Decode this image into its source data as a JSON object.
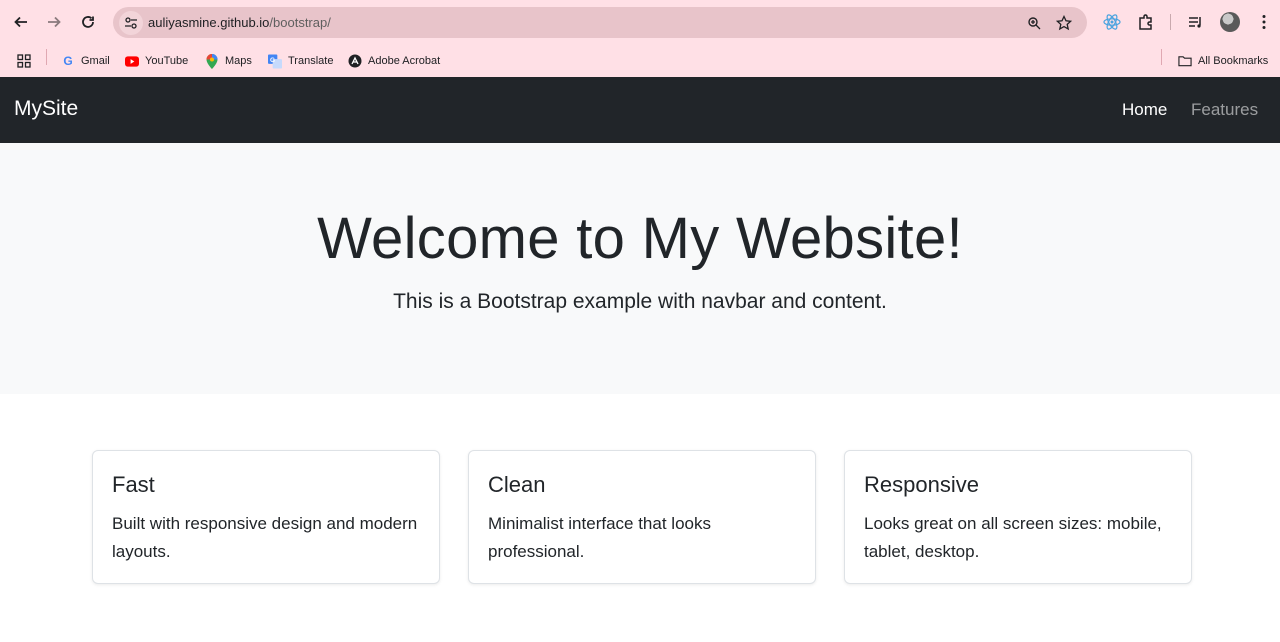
{
  "browser": {
    "url_host": "auliyasmine.github.io",
    "url_path": "/bootstrap/",
    "bookmarks": [
      {
        "label": "Gmail",
        "icon": "gmail-icon"
      },
      {
        "label": "YouTube",
        "icon": "youtube-icon"
      },
      {
        "label": "Maps",
        "icon": "maps-icon"
      },
      {
        "label": "Translate",
        "icon": "translate-icon"
      },
      {
        "label": "Adobe Acrobat",
        "icon": "adobe-acrobat-icon"
      }
    ],
    "all_bookmarks": "All Bookmarks",
    "colors": {
      "chrome_bg": "#ffe0e6",
      "omnibox_bg": "#e8c4ca"
    }
  },
  "site": {
    "brand": "MySite",
    "nav": {
      "home": "Home",
      "features": "Features"
    },
    "hero": {
      "title": "Welcome to My Website!",
      "lead": "This is a Bootstrap example with navbar and content."
    },
    "cards": [
      {
        "title": "Fast",
        "text": "Built with responsive design and modern layouts."
      },
      {
        "title": "Clean",
        "text": "Minimalist interface that looks professional."
      },
      {
        "title": "Responsive",
        "text": "Looks great on all screen sizes: mobile, tablet, desktop."
      }
    ],
    "colors": {
      "navbar_bg": "#212529",
      "hero_bg": "#f8f9fa"
    }
  }
}
